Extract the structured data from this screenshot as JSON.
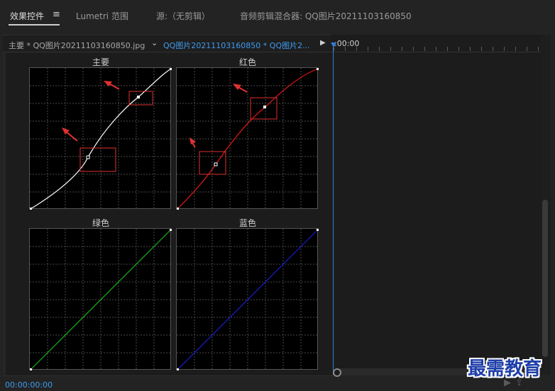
{
  "tabs": [
    {
      "label": "效果控件"
    },
    {
      "label": "Lumetri 范围"
    },
    {
      "label": "源:（无剪辑）"
    },
    {
      "label": "音频剪辑混合器: QQ图片20211103160850"
    }
  ],
  "clip_bar": {
    "master_clip": "主要 * QQ图片20211103160850.jpg",
    "sequence_clip": "QQ图片20211103160850  * QQ图片2..."
  },
  "timeline": {
    "ruler_start": ":00:00"
  },
  "curves": {
    "master": {
      "title": "主要",
      "color": "#ffffff"
    },
    "red": {
      "title": "红色",
      "color": "#e01818"
    },
    "green": {
      "title": "绿色",
      "color": "#17b317"
    },
    "blue": {
      "title": "蓝色",
      "color": "#1a1acf"
    }
  },
  "status": {
    "timecode": "00:00:00:00"
  },
  "watermark": "最需教育"
}
